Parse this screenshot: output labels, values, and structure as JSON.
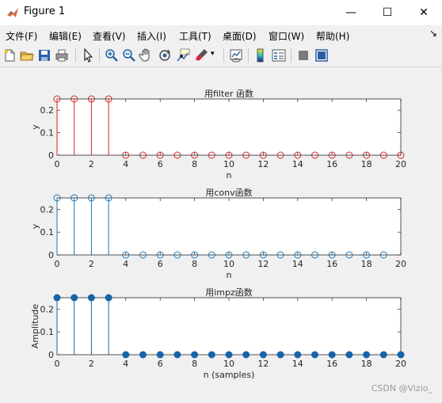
{
  "window": {
    "title": "Figure 1",
    "minimize_glyph": "—",
    "maximize_glyph": "☐",
    "close_glyph": "✕"
  },
  "menu": {
    "items": [
      "文件(F)",
      "编辑(E)",
      "查看(V)",
      "插入(I)",
      "工具(T)",
      "桌面(D)",
      "窗口(W)",
      "帮助(H)"
    ],
    "overflow_glyph": "↘"
  },
  "toolbar": {
    "icons": [
      "new-figure-icon",
      "open-file-icon",
      "save-icon",
      "print-icon",
      "pointer-icon",
      "zoom-in-icon",
      "zoom-out-icon",
      "pan-icon",
      "rotate-icon",
      "data-cursor-icon",
      "brush-icon",
      "link-plot-icon",
      "colorbar-icon",
      "legend-icon",
      "hide-plot-tools-icon",
      "show-plot-tools-icon"
    ]
  },
  "watermark": "CSDN @Vizio_",
  "colors": {
    "red": "#d62728",
    "blue": "#1f77b4",
    "filled_blue": "#1565a8"
  },
  "chart_data": [
    {
      "type": "stem",
      "title": "用filter 函数",
      "xlabel": "n",
      "ylabel": "y",
      "color": "#d62728",
      "marker": "open-circle",
      "xlim": [
        0,
        20
      ],
      "ylim": [
        0,
        0.25
      ],
      "xticks": [
        0,
        2,
        4,
        6,
        8,
        10,
        12,
        14,
        16,
        18,
        20
      ],
      "yticks": [
        0,
        0.1,
        0.2
      ],
      "x": [
        0,
        1,
        2,
        3,
        4,
        5,
        6,
        7,
        8,
        9,
        10,
        11,
        12,
        13,
        14,
        15,
        16,
        17,
        18,
        19,
        20
      ],
      "values": [
        0.25,
        0.25,
        0.25,
        0.25,
        0,
        0,
        0,
        0,
        0,
        0,
        0,
        0,
        0,
        0,
        0,
        0,
        0,
        0,
        0,
        0,
        0
      ]
    },
    {
      "type": "stem",
      "title": "用conv函数",
      "xlabel": "n",
      "ylabel": "y",
      "color": "#1f77b4",
      "marker": "open-circle",
      "xlim": [
        0,
        20
      ],
      "ylim": [
        0,
        0.25
      ],
      "xticks": [
        0,
        2,
        4,
        6,
        8,
        10,
        12,
        14,
        16,
        18,
        20
      ],
      "yticks": [
        0,
        0.1,
        0.2
      ],
      "x": [
        0,
        1,
        2,
        3,
        4,
        5,
        6,
        7,
        8,
        9,
        10,
        11,
        12,
        13,
        14,
        15,
        16,
        17,
        18,
        19
      ],
      "values": [
        0.25,
        0.25,
        0.25,
        0.25,
        0,
        0,
        0,
        0,
        0,
        0,
        0,
        0,
        0,
        0,
        0,
        0,
        0,
        0,
        0,
        0
      ]
    },
    {
      "type": "stem",
      "title": "用impz函数",
      "xlabel": "n (samples)",
      "ylabel": "Amplitude",
      "color": "#1565a8",
      "marker": "filled-circle",
      "xlim": [
        0,
        20
      ],
      "ylim": [
        0,
        0.25
      ],
      "xticks": [
        0,
        2,
        4,
        6,
        8,
        10,
        12,
        14,
        16,
        18,
        20
      ],
      "yticks": [
        0,
        0.1,
        0.2
      ],
      "x": [
        0,
        1,
        2,
        3,
        4,
        5,
        6,
        7,
        8,
        9,
        10,
        11,
        12,
        13,
        14,
        15,
        16,
        17,
        18,
        19,
        20
      ],
      "values": [
        0.25,
        0.25,
        0.25,
        0.25,
        0,
        0,
        0,
        0,
        0,
        0,
        0,
        0,
        0,
        0,
        0,
        0,
        0,
        0,
        0,
        0,
        0
      ]
    }
  ]
}
